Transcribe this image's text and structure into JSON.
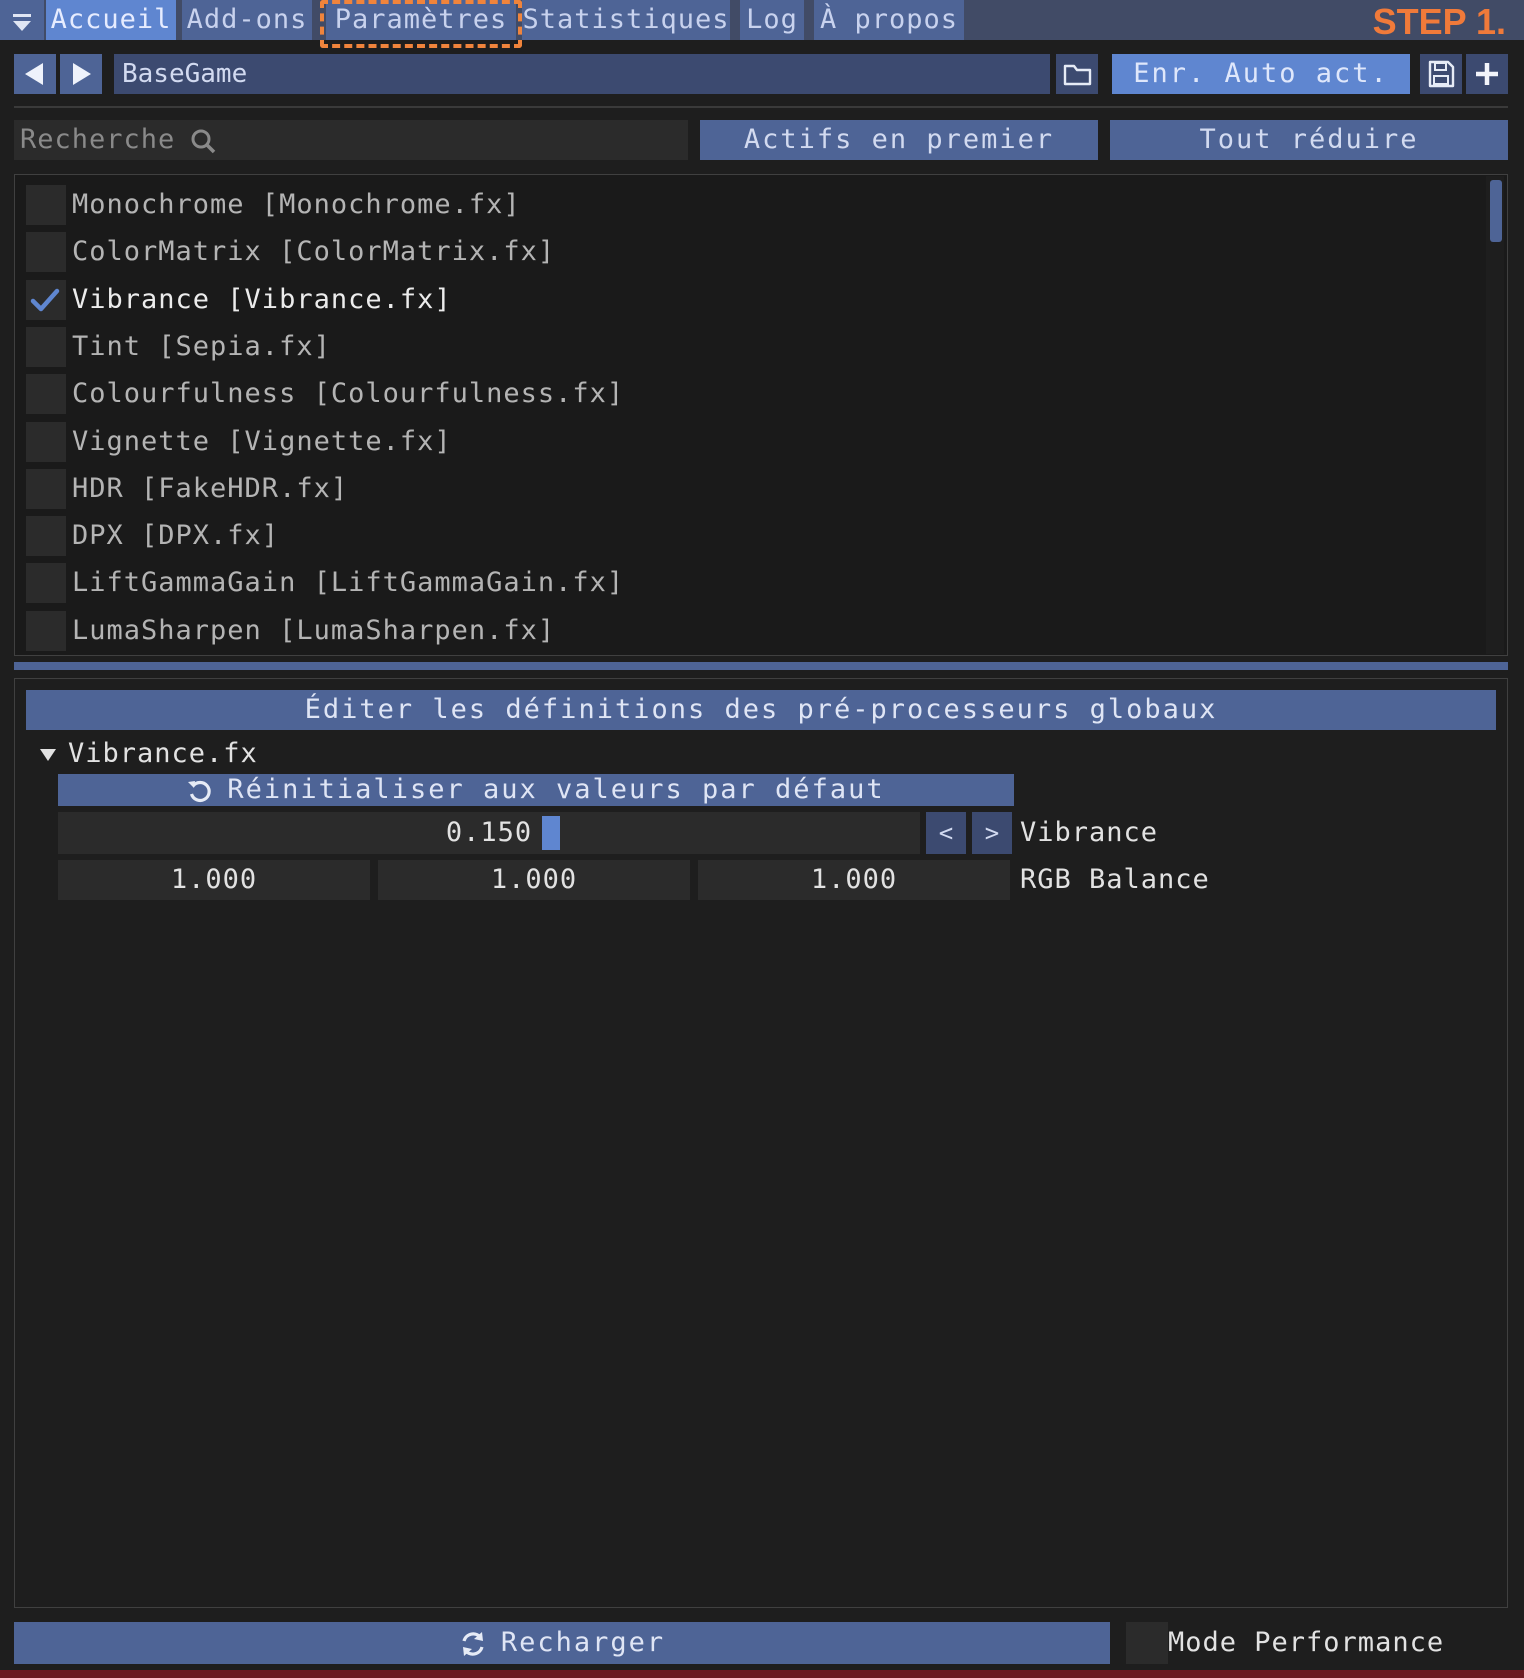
{
  "tabs": [
    {
      "label": "Accueil"
    },
    {
      "label": "Add-ons"
    },
    {
      "label": "Paramètres"
    },
    {
      "label": "Statistiques"
    },
    {
      "label": "Log"
    },
    {
      "label": "À propos"
    }
  ],
  "step_label": "STEP 1.",
  "toolbar": {
    "preset_name": "BaseGame",
    "autosave_label": "Enr. Auto act."
  },
  "search": {
    "placeholder": "Recherche",
    "active_first_label": "Actifs en premier",
    "collapse_all_label": "Tout réduire"
  },
  "effects": [
    {
      "label": "Monochrome [Monochrome.fx]",
      "enabled": false
    },
    {
      "label": "ColorMatrix [ColorMatrix.fx]",
      "enabled": false
    },
    {
      "label": "Vibrance [Vibrance.fx]",
      "enabled": true
    },
    {
      "label": "Tint [Sepia.fx]",
      "enabled": false
    },
    {
      "label": "Colourfulness [Colourfulness.fx]",
      "enabled": false
    },
    {
      "label": "Vignette [Vignette.fx]",
      "enabled": false
    },
    {
      "label": "HDR [FakeHDR.fx]",
      "enabled": false
    },
    {
      "label": "DPX [DPX.fx]",
      "enabled": false
    },
    {
      "label": "LiftGammaGain [LiftGammaGain.fx]",
      "enabled": false
    },
    {
      "label": "LumaSharpen [LumaSharpen.fx]",
      "enabled": false
    }
  ],
  "settings": {
    "header": "Éditer les définitions des pré-processeurs globaux",
    "section": "Vibrance.fx",
    "reset_label": "Réinitialiser aux valeurs par défaut",
    "vibrance": {
      "value": "0.150",
      "label": "Vibrance",
      "dec": "<",
      "inc": ">"
    },
    "rgb_balance": {
      "values": [
        "1.000",
        "1.000",
        "1.000"
      ],
      "label": "RGB Balance"
    }
  },
  "footer": {
    "reload_label": "Recharger",
    "performance_label": "Mode Performance",
    "performance_enabled": false
  },
  "colors": {
    "accent": "#5f86d0",
    "button": "#4e6496",
    "highlight": "#f0843c"
  }
}
